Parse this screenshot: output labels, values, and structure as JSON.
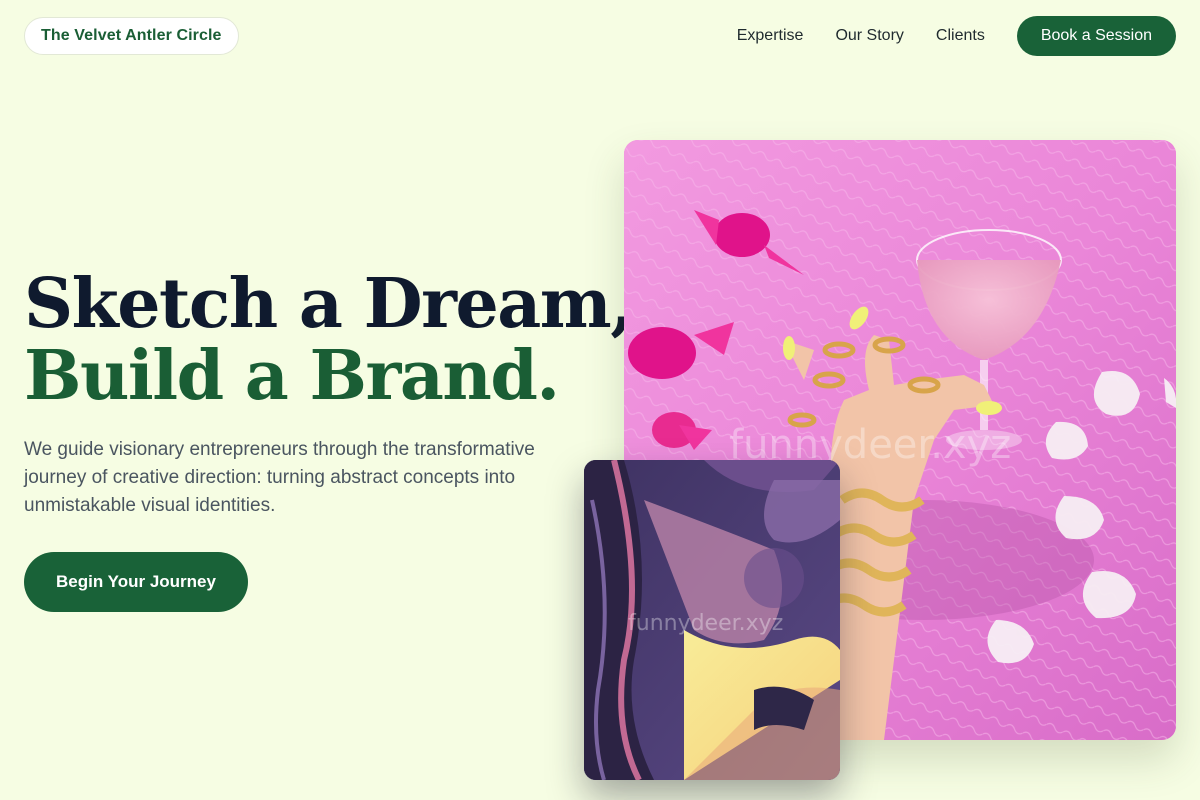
{
  "brand": {
    "name": "The Velvet Antler Circle"
  },
  "nav": {
    "links": [
      "Expertise",
      "Our Story",
      "Clients"
    ],
    "cta_label": "Book a Session"
  },
  "hero": {
    "headline_line1": "Sketch a Dream,",
    "headline_line2": "Build a Brand.",
    "subcopy": "We guide visionary entrepreneurs through the transformative journey of creative direction: turning abstract concepts into unmistakable visual identities.",
    "cta_label": "Begin Your Journey"
  },
  "images": {
    "main": {
      "subject": "hand-with-cocktail-on-pink-fur",
      "watermark": "funnydeer.xyz"
    },
    "secondary": {
      "subject": "abstract-purple-yellow-painting",
      "watermark": "funnydeer.xyz"
    }
  },
  "colors": {
    "background": "#f6fde3",
    "brand_green": "#196238",
    "headline_dark": "#0f1a2e",
    "headline_green": "#1a5e35"
  }
}
